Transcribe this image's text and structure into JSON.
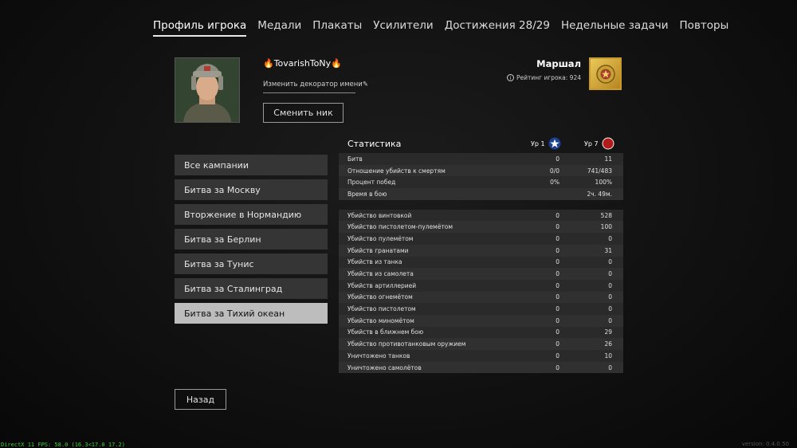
{
  "tabs": [
    {
      "label": "Профиль игрока"
    },
    {
      "label": "Медали"
    },
    {
      "label": "Плакаты"
    },
    {
      "label": "Усилители"
    },
    {
      "label": "Достижения 28/29"
    },
    {
      "label": "Недельные задачи"
    },
    {
      "label": "Повторы"
    }
  ],
  "profile": {
    "nickname": "🔥TovarishToNy🔥",
    "decorator_label": "Изменить декоратор имени",
    "change_nick_label": "Сменить ник",
    "rank_title": "Маршал",
    "rating_label": "Рейтинг игрока: 924"
  },
  "campaigns": [
    {
      "label": "Все кампании"
    },
    {
      "label": "Битва за Москву"
    },
    {
      "label": "Вторжение в Нормандию"
    },
    {
      "label": "Битва за Берлин"
    },
    {
      "label": "Битва за Тунис"
    },
    {
      "label": "Битва за Сталинград"
    },
    {
      "label": "Битва за Тихий океан"
    }
  ],
  "stats": {
    "title": "Статистика",
    "col1_label": "Ур 1",
    "col2_label": "Ур 7",
    "summary": [
      {
        "label": "Битв",
        "v1": "0",
        "v2": "11"
      },
      {
        "label": "Отношение убийств к смертям",
        "v1": "0/0",
        "v2": "741/483"
      },
      {
        "label": "Процент побед",
        "v1": "0%",
        "v2": "100%"
      },
      {
        "label": "Время в бою",
        "v1": "",
        "v2": "2ч. 49м."
      }
    ],
    "kills": [
      {
        "label": "Убийство винтовкой",
        "v1": "0",
        "v2": "528"
      },
      {
        "label": "Убийство пистолетом-пулемётом",
        "v1": "0",
        "v2": "100"
      },
      {
        "label": "Убийство пулемётом",
        "v1": "0",
        "v2": "0"
      },
      {
        "label": "Убийств гранатами",
        "v1": "0",
        "v2": "31"
      },
      {
        "label": "Убийств из танка",
        "v1": "0",
        "v2": "0"
      },
      {
        "label": "Убийств из самолета",
        "v1": "0",
        "v2": "0"
      },
      {
        "label": "Убийств артиллерией",
        "v1": "0",
        "v2": "0"
      },
      {
        "label": "Убийство огнемётом",
        "v1": "0",
        "v2": "0"
      },
      {
        "label": "Убийство пистолетом",
        "v1": "0",
        "v2": "0"
      },
      {
        "label": "Убийство миномётом",
        "v1": "0",
        "v2": "0"
      },
      {
        "label": "Убийств в ближнем бою",
        "v1": "0",
        "v2": "29"
      },
      {
        "label": "Убийство противотанковым оружием",
        "v1": "0",
        "v2": "26"
      },
      {
        "label": "Уничтожено танков",
        "v1": "0",
        "v2": "10"
      },
      {
        "label": "Уничтожено самолётов",
        "v1": "0",
        "v2": "0"
      }
    ]
  },
  "back_label": "Назад",
  "fps_text": "DirectX 11 FPS: 58.0 (16.3<17.0 17.2)",
  "version_text": "version: 0.4.0.50",
  "colors": {
    "accent_badge": "#c79a2c",
    "active_campaign": "#bdbdbd",
    "fps": "#3ecf3e"
  }
}
